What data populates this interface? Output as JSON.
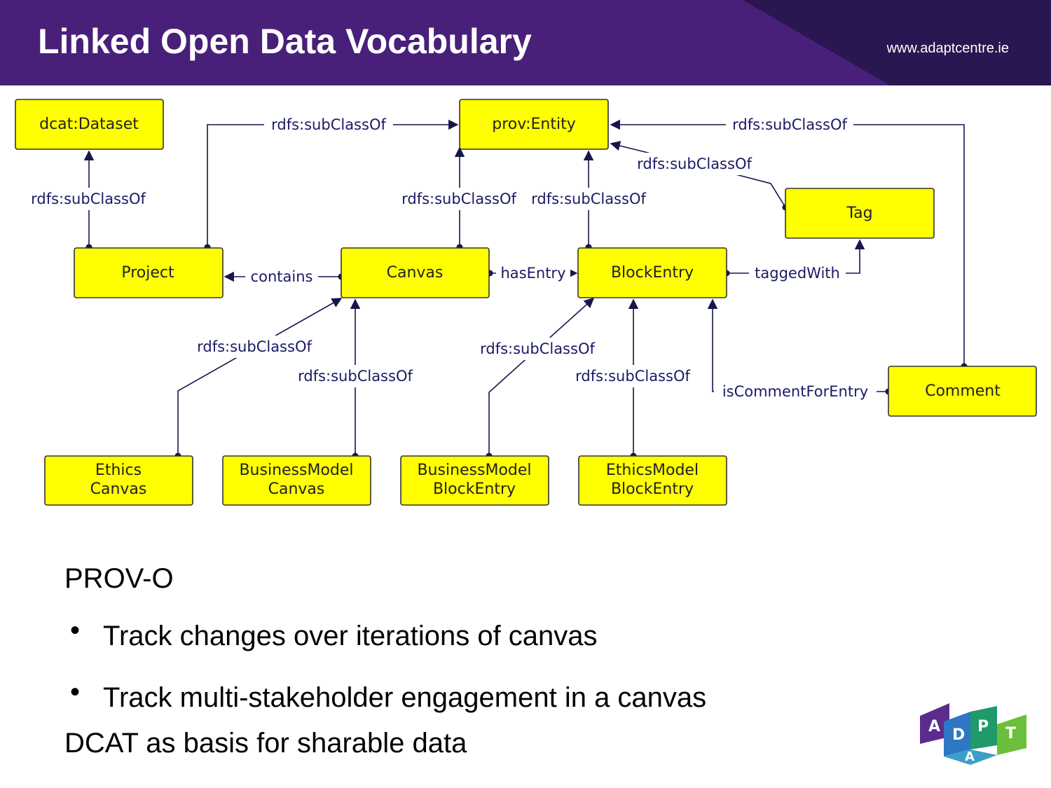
{
  "header": {
    "title": "Linked Open Data Vocabulary",
    "url": "www.adaptcentre.ie",
    "colors": {
      "background": "#48207a",
      "dark_accent": "#2a1650",
      "text": "#ffffff"
    }
  },
  "diagram": {
    "node_color": "#ffff00",
    "edge_color": "#16164d",
    "nodes": {
      "dcat_dataset": "dcat:Dataset",
      "prov_entity": "prov:Entity",
      "tag": "Tag",
      "project": "Project",
      "canvas": "Canvas",
      "block_entry": "BlockEntry",
      "comment": "Comment",
      "ethics_canvas": [
        "Ethics",
        "Canvas"
      ],
      "business_model_canvas": [
        "BusinessModel",
        "Canvas"
      ],
      "business_model_block_entry": [
        "BusinessModel",
        "BlockEntry"
      ],
      "ethics_model_block_entry": [
        "EthicsModel",
        "BlockEntry"
      ]
    },
    "edge_labels": {
      "project_dataset": "rdfs:subClassOf",
      "project_entity": "rdfs:subClassOf",
      "canvas_entity": "rdfs:subClassOf",
      "blockentry_entity": "rdfs:subClassOf",
      "tag_entity": "rdfs:subClassOf",
      "comment_entity": "rdfs:subClassOf",
      "contains": "contains",
      "has_entry": "hasEntry",
      "tagged_with": "taggedWith",
      "is_comment_for_entry": "isCommentForEntry",
      "ethics_canvas_sub": "rdfs:subClassOf",
      "bm_canvas_sub": "rdfs:subClassOf",
      "bm_block_sub": "rdfs:subClassOf",
      "ethics_block_sub": "rdfs:subClassOf"
    }
  },
  "body": {
    "heading1": "PROV-O",
    "bullets": [
      "Track changes over iterations of canvas",
      "Track multi-stakeholder engagement in a canvas"
    ],
    "heading2": "DCAT as basis for sharable data"
  },
  "logo": {
    "letters": [
      "A",
      "D",
      "A",
      "P",
      "T"
    ],
    "colors": [
      "#5b2c8e",
      "#2f76c4",
      "#3aa0c8",
      "#1e9a6b",
      "#6bbf3a"
    ]
  }
}
